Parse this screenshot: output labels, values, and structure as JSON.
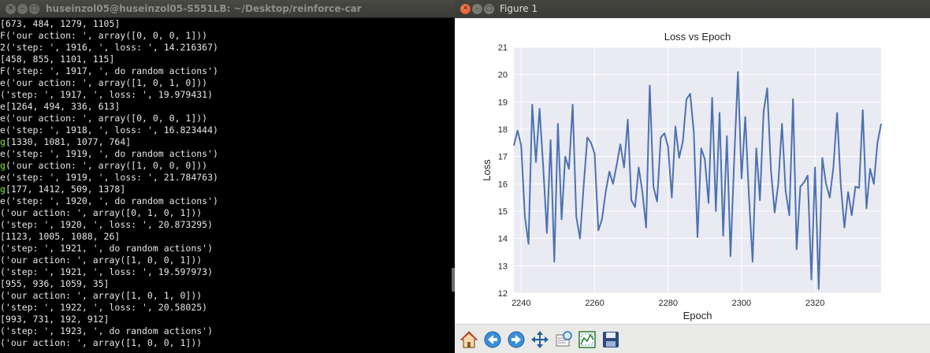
{
  "terminal": {
    "title": "huseinzol05@huseinzol05-S551LB: ~/Desktop/reinforce-car",
    "lines": [
      {
        "prefix": "",
        "text": "[673, 484, 1279, 1105]"
      },
      {
        "prefix": "F",
        "text": "('our action: ', array([0, 0, 0, 1]))"
      },
      {
        "prefix": "2",
        "text": "('step: ', 1916, ', loss: ', 14.216367)"
      },
      {
        "prefix": "",
        "text": "[458, 855, 1101, 115]"
      },
      {
        "prefix": "F",
        "text": "('step: ', 1917, ', do random actions')"
      },
      {
        "prefix": "e",
        "text": "('our action: ', array([1, 0, 1, 0]))"
      },
      {
        "prefix": "",
        "text": "('step: ', 1917, ', loss: ', 19.979431)"
      },
      {
        "prefix": "e",
        "text": "[1264, 494, 336, 613]"
      },
      {
        "prefix": "e",
        "text": "('our action: ', array([0, 0, 0, 1]))"
      },
      {
        "prefix": "e",
        "text": "('step: ', 1918, ', loss: ', 16.823444)"
      },
      {
        "prefix": "g",
        "text": "[1330, 1081, 1077, 764]"
      },
      {
        "prefix": "e",
        "text": "('step: ', 1919, ', do random actions')"
      },
      {
        "prefix": "g",
        "text": "('our action: ', array([1, 0, 0, 0]))"
      },
      {
        "prefix": "e",
        "text": "('step: ', 1919, ', loss: ', 21.784763)"
      },
      {
        "prefix": "g",
        "text": "[177, 1412, 509, 1378]"
      },
      {
        "prefix": "e",
        "text": "('step: ', 1920, ', do random actions')"
      },
      {
        "prefix": "",
        "text": "('our action: ', array([0, 1, 0, 1]))"
      },
      {
        "prefix": "",
        "text": "('step: ', 1920, ', loss: ', 20.873295)"
      },
      {
        "prefix": "",
        "text": "[1123, 1005, 1088, 26]"
      },
      {
        "prefix": "",
        "text": "('step: ', 1921, ', do random actions')"
      },
      {
        "prefix": "",
        "text": "('our action: ', array([1, 0, 0, 1]))"
      },
      {
        "prefix": "",
        "text": "('step: ', 1921, ', loss: ', 19.597973)"
      },
      {
        "prefix": "",
        "text": "[955, 936, 1059, 35]"
      },
      {
        "prefix": "",
        "text": "('our action: ', array([1, 0, 1, 0]))"
      },
      {
        "prefix": "",
        "text": "('step: ', 1922, ', loss: ', 20.58025)"
      },
      {
        "prefix": "",
        "text": "[993, 731, 192, 912]"
      },
      {
        "prefix": "",
        "text": "('step: ', 1923, ', do random actions')"
      },
      {
        "prefix": "",
        "text": "('our action: ', array([1, 0, 0, 1]))"
      }
    ],
    "prefix_colors": {
      "default": "#e6e6e6",
      "highlight": "#8ae234"
    }
  },
  "figure": {
    "title": "Figure 1",
    "toolbar": [
      {
        "name": "home-icon",
        "label": "Home"
      },
      {
        "name": "back-icon",
        "label": "Back"
      },
      {
        "name": "forward-icon",
        "label": "Forward"
      },
      {
        "name": "pan-icon",
        "label": "Pan"
      },
      {
        "name": "zoom-icon",
        "label": "Zoom"
      },
      {
        "name": "subplots-icon",
        "label": "Subplots"
      },
      {
        "name": "save-icon",
        "label": "Save"
      }
    ]
  },
  "chart_data": {
    "type": "line",
    "title": "Loss vs Epoch",
    "xlabel": "Epoch",
    "ylabel": "Loss",
    "xlim": [
      2238,
      2338
    ],
    "ylim": [
      12,
      21
    ],
    "xticks": [
      2240,
      2260,
      2280,
      2300,
      2320
    ],
    "yticks": [
      12,
      13,
      14,
      15,
      16,
      17,
      18,
      19,
      20,
      21
    ],
    "grid": true,
    "background": "#eaeaf2",
    "line_color": "#4c72b0",
    "x": [
      2238,
      2239,
      2240,
      2241,
      2242,
      2243,
      2244,
      2245,
      2246,
      2247,
      2248,
      2249,
      2250,
      2251,
      2252,
      2253,
      2254,
      2255,
      2256,
      2257,
      2258,
      2259,
      2260,
      2261,
      2262,
      2263,
      2264,
      2265,
      2266,
      2267,
      2268,
      2269,
      2270,
      2271,
      2272,
      2273,
      2274,
      2275,
      2276,
      2277,
      2278,
      2279,
      2280,
      2281,
      2282,
      2283,
      2284,
      2285,
      2286,
      2287,
      2288,
      2289,
      2290,
      2291,
      2292,
      2293,
      2294,
      2295,
      2296,
      2297,
      2298,
      2299,
      2300,
      2301,
      2302,
      2303,
      2304,
      2305,
      2306,
      2307,
      2308,
      2309,
      2310,
      2311,
      2312,
      2313,
      2314,
      2315,
      2316,
      2317,
      2318,
      2319,
      2320,
      2321,
      2322,
      2323,
      2324,
      2325,
      2326,
      2327,
      2328,
      2329,
      2330,
      2331,
      2332,
      2333,
      2334,
      2335,
      2336,
      2337,
      2338
    ],
    "y": [
      17.4,
      17.95,
      17.4,
      14.8,
      13.8,
      18.9,
      16.8,
      18.75,
      16.6,
      14.2,
      17.6,
      13.15,
      18.2,
      14.7,
      17.0,
      16.55,
      18.9,
      14.8,
      14.0,
      15.9,
      17.7,
      17.5,
      17.1,
      14.3,
      14.7,
      15.7,
      16.45,
      16.0,
      16.7,
      17.45,
      16.6,
      18.35,
      15.4,
      15.15,
      16.6,
      15.7,
      14.4,
      19.6,
      15.9,
      15.35,
      17.7,
      17.85,
      17.35,
      15.5,
      18.1,
      16.95,
      17.55,
      19.1,
      19.3,
      17.9,
      14.05,
      17.3,
      16.9,
      15.3,
      19.15,
      15.0,
      18.6,
      14.1,
      17.75,
      13.35,
      16.9,
      20.1,
      16.2,
      18.45,
      15.6,
      13.15,
      17.3,
      15.4,
      18.65,
      19.5,
      16.5,
      14.95,
      16.0,
      18.2,
      15.75,
      14.85,
      19.1,
      13.6,
      15.9,
      16.05,
      16.3,
      12.5,
      16.6,
      12.15,
      16.95,
      16.0,
      15.5,
      16.6,
      18.6,
      16.0,
      14.4,
      15.7,
      14.85,
      15.9,
      15.85,
      18.7,
      15.1,
      16.55,
      16.0,
      17.5,
      18.2
    ]
  }
}
